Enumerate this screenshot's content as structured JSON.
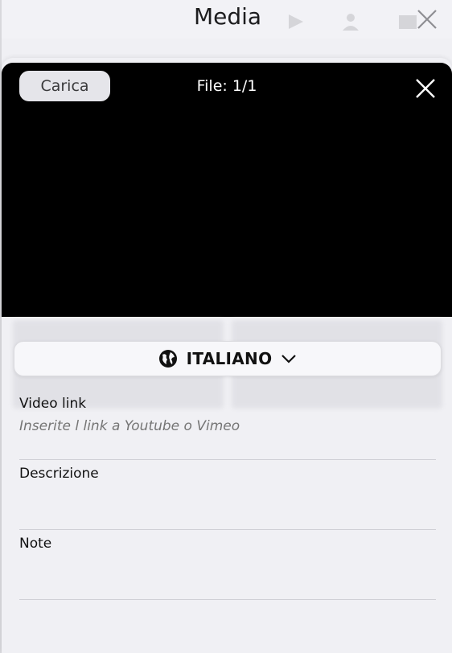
{
  "background": {
    "title": "Media",
    "icons": [
      "send-icon",
      "user-icon",
      "gallery-icon",
      "close-icon"
    ]
  },
  "media_sheet": {
    "upload_label": "Carica",
    "file_counter": "File: 1/1",
    "close_icon": "close-icon"
  },
  "language": {
    "globe_icon": "globe-icon",
    "label": "ITALIANO",
    "chevron_icon": "chevron-down-icon"
  },
  "fields": {
    "video_link": {
      "label": "Video link",
      "placeholder": "Inserite l link a Youtube o Vimeo"
    },
    "description": {
      "label": "Descrizione"
    },
    "note": {
      "label": "Note"
    }
  },
  "colors": {
    "media_background": "#000000",
    "sheet_background": "#f0f0f4",
    "upload_button": "#e5e5ea"
  }
}
